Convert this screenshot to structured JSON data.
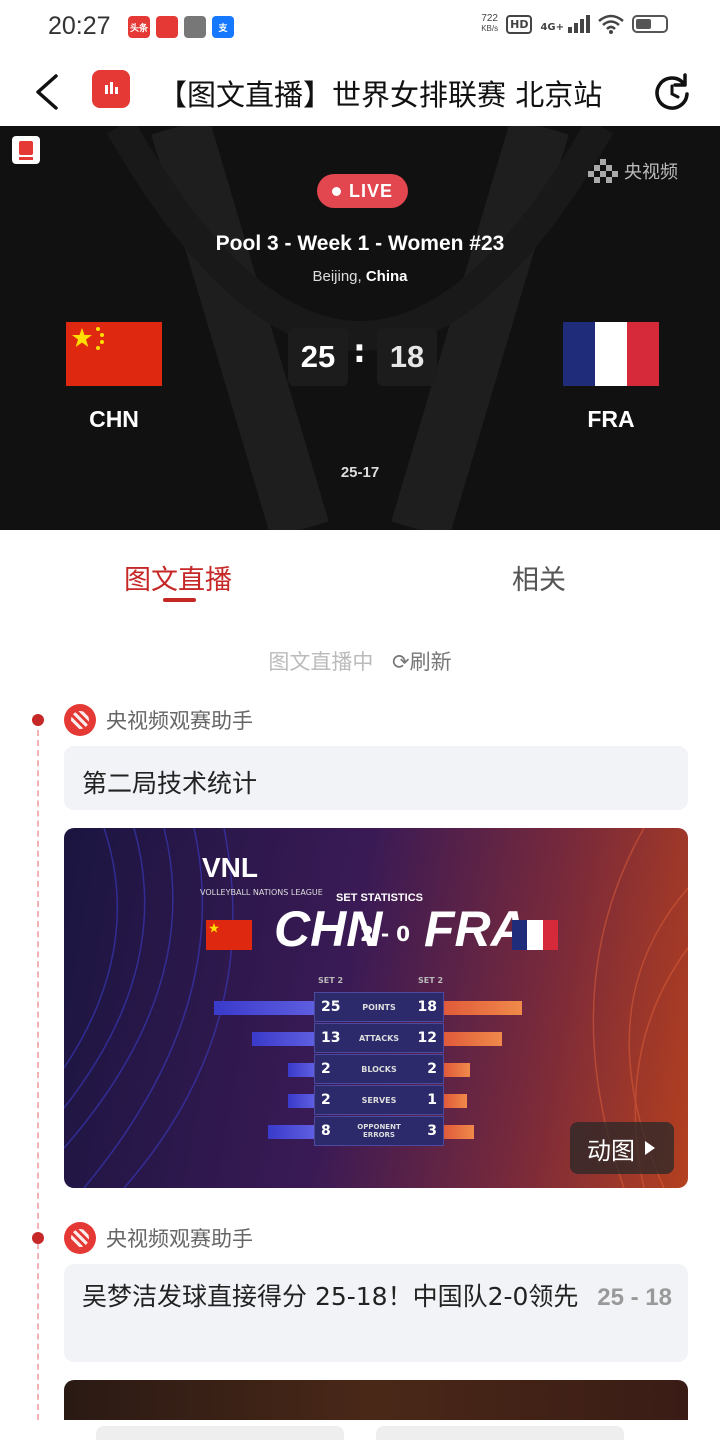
{
  "status_bar": {
    "time": "20:27",
    "net_speed_value": "722",
    "net_speed_unit": "KB/s",
    "hd": "HD",
    "network": "4G+",
    "apps": [
      {
        "label": "头条",
        "color": "#e53935"
      },
      {
        "label": "",
        "color": "#e53935"
      },
      {
        "label": "",
        "color": "#666666"
      },
      {
        "label": "支",
        "color": "#1677ff"
      }
    ],
    "battery_level": 0.55
  },
  "header": {
    "title": "【图文直播】世界女排联赛 北京站"
  },
  "match": {
    "live_label": "LIVE",
    "name": "Pool 3 - Week 1 - Women #23",
    "city": "Beijing",
    "country": "China",
    "broadcaster": "央视频",
    "home_code": "CHN",
    "away_code": "FRA",
    "home_score": "25",
    "away_score": "18",
    "separator": ":",
    "set_scores": "25-17"
  },
  "tabs": [
    {
      "label": "图文直播",
      "active": true
    },
    {
      "label": "相关",
      "active": false
    }
  ],
  "live_status": {
    "text": "图文直播中",
    "refresh_label": "刷新"
  },
  "posts": [
    {
      "author": "央视频观赛助手",
      "text": "第二局技术统计",
      "image": {
        "league": "VNL",
        "league_sub": "VOLLEYBALL NATIONS LEAGUE",
        "title": "SET STATISTICS",
        "home": "CHN",
        "away": "FRA",
        "result": "2 - 0",
        "set_label": "SET 2",
        "stats": [
          {
            "label": "POINTS",
            "home": "25",
            "away": "18"
          },
          {
            "label": "ATTACKS",
            "home": "13",
            "away": "12"
          },
          {
            "label": "BLOCKS",
            "home": "2",
            "away": "2"
          },
          {
            "label": "SERVES",
            "home": "2",
            "away": "1"
          },
          {
            "label": "OPPONENT ERRORS",
            "home": "8",
            "away": "3"
          }
        ],
        "badge": "动图"
      }
    },
    {
      "author": "央视频观赛助手",
      "text": "吴梦洁发球直接得分 25-18！中国队2-0领先",
      "score": "25 - 18"
    }
  ],
  "colors": {
    "accent": "#c62828",
    "live_badge": "#e2464e"
  }
}
